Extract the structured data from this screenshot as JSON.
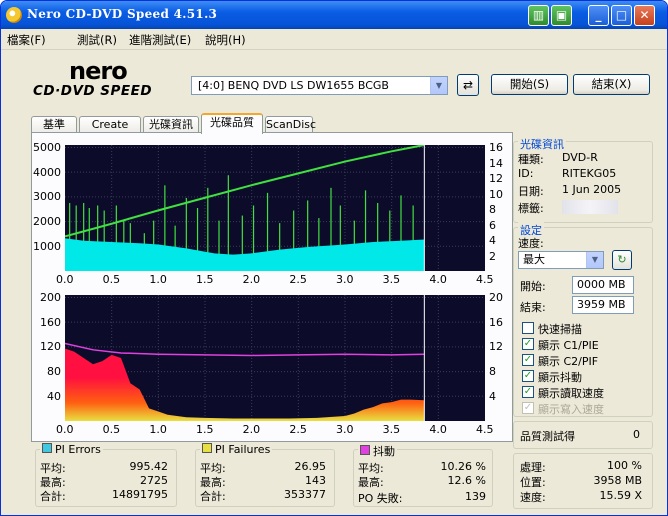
{
  "window": {
    "title": "Nero CD-DVD Speed 4.51.3"
  },
  "menu": [
    "檔案(F)",
    "測試(R)",
    "進階測試(E)",
    "說明(H)"
  ],
  "logo": {
    "brand": "nero",
    "product": "CD·DVD SPEED"
  },
  "drive": {
    "selected": "[4:0]  BENQ DVD LS DW1655 BCGB"
  },
  "buttons": {
    "start": "開始(S)",
    "end": "結束(X)"
  },
  "tabs": [
    "基準",
    "Create Disc",
    "光碟資訊",
    "光碟品質",
    "ScanDisc"
  ],
  "active_tab": "光碟品質",
  "disc_info": {
    "header": "光碟資訊",
    "type_label": "種類:",
    "type_value": "DVD-R",
    "id_label": "ID:",
    "id_value": "RITEKG05",
    "date_label": "日期:",
    "date_value": "1 Jun 2005",
    "label_label": "標籤:",
    "label_value": ""
  },
  "settings": {
    "header": "設定",
    "speed_label": "速度:",
    "speed_value": "最大",
    "start_label": "開始:",
    "start_value": "0000 MB",
    "end_label": "結束:",
    "end_value": "3959 MB",
    "checkboxes": [
      {
        "label": "快速掃描",
        "checked": false,
        "enabled": true
      },
      {
        "label": "顯示 C1/PIE",
        "checked": true,
        "enabled": true
      },
      {
        "label": "顯示 C2/PIF",
        "checked": true,
        "enabled": true
      },
      {
        "label": "顯示抖動",
        "checked": true,
        "enabled": true
      },
      {
        "label": "顯示讀取速度",
        "checked": true,
        "enabled": true
      },
      {
        "label": "顯示寫入速度",
        "checked": true,
        "enabled": false
      }
    ]
  },
  "quality": {
    "label": "品質測試得",
    "value": "0"
  },
  "progress": {
    "process_label": "處理:",
    "process_value": "100 %",
    "position_label": "位置:",
    "position_value": "3958 MB",
    "speed_label": "速度:",
    "speed_value": "15.59 X"
  },
  "pi_errors": {
    "title": "PI Errors",
    "color": "#40c8e0",
    "avg_label": "平均:",
    "avg": "995.42",
    "max_label": "最高:",
    "max": "2725",
    "total_label": "合計:",
    "total": "14891795"
  },
  "pi_failures": {
    "title": "PI Failures",
    "color": "#e8e040",
    "avg_label": "平均:",
    "avg": "26.95",
    "max_label": "最高:",
    "max": "143",
    "total_label": "合計:",
    "total": "353377"
  },
  "jitter": {
    "title": "抖動",
    "color": "#e040e0",
    "avg_label": "平均:",
    "avg": "10.26 %",
    "max_label": "最高:",
    "max": "12.6 %",
    "po_label": "PO 失敗:",
    "po": "139"
  },
  "chart_data": [
    {
      "type": "area",
      "x_ticks": [
        "0.0",
        "0.5",
        "1.0",
        "1.5",
        "2.0",
        "2.5",
        "3.0",
        "3.5",
        "4.0",
        "4.5"
      ],
      "y_left_ticks": [
        "5000",
        "4000",
        "3000",
        "2000",
        "1000"
      ],
      "y_right_ticks": [
        "16",
        "14",
        "12",
        "10",
        "8",
        "6",
        "4",
        "2"
      ],
      "xlim": [
        0,
        4.5
      ],
      "ylim_left": [
        0,
        5000
      ],
      "ylim_right": [
        0,
        16
      ],
      "series": [
        {
          "color": "#00e8e8",
          "x": [
            0.0,
            0.2,
            0.5,
            0.8,
            1.0,
            1.3,
            1.6,
            1.8,
            2.0,
            2.3,
            2.6,
            3.0,
            3.3,
            3.6,
            3.85
          ],
          "y": [
            1300,
            1200,
            1150,
            1100,
            1050,
            900,
            700,
            650,
            700,
            850,
            950,
            1050,
            1150,
            1200,
            1250
          ]
        },
        {
          "color": "#40e040",
          "x": [
            0.0,
            0.5,
            1.0,
            1.5,
            2.0,
            2.5,
            3.0,
            3.5,
            3.85
          ],
          "y": [
            4.4,
            6.0,
            7.7,
            9.3,
            10.9,
            12.4,
            13.9,
            15.2,
            16.0
          ]
        }
      ],
      "spikes_x": [
        0.05,
        0.12,
        0.2,
        0.26,
        0.35,
        0.42,
        0.55,
        0.63,
        0.7,
        0.85,
        0.95,
        1.07,
        1.18,
        1.3,
        1.42,
        1.53,
        1.65,
        1.75,
        1.9,
        2.02,
        2.17,
        2.3,
        2.45,
        2.6,
        2.72,
        2.85,
        2.95,
        3.1,
        3.22,
        3.35,
        3.48,
        3.6,
        3.73
      ],
      "spikes_y": [
        2700,
        2600,
        2700,
        2500,
        2600,
        2400,
        2600,
        2000,
        1900,
        1500,
        2000,
        3400,
        1800,
        2900,
        2500,
        3300,
        2000,
        3800,
        2200,
        2600,
        3100,
        1900,
        2400,
        2800,
        2100,
        3300,
        2600,
        2000,
        3200,
        2700,
        2400,
        3000,
        2600
      ]
    },
    {
      "type": "area",
      "x_ticks": [
        "0.0",
        "0.5",
        "1.0",
        "1.5",
        "2.0",
        "2.5",
        "3.0",
        "3.5",
        "4.0",
        "4.5"
      ],
      "y_left_ticks": [
        "200",
        "160",
        "120",
        "80",
        "40"
      ],
      "y_right_ticks": [
        "20",
        "16",
        "12",
        "8",
        "4"
      ],
      "xlim": [
        0,
        4.5
      ],
      "ylim_left": [
        0,
        200
      ],
      "ylim_right": [
        0,
        20
      ],
      "series": [
        {
          "color": "#ff2020",
          "x": [
            0.0,
            0.1,
            0.2,
            0.3,
            0.4,
            0.5,
            0.6,
            0.7,
            0.8,
            0.9,
            1.0,
            1.1,
            1.2,
            1.3,
            1.5,
            1.8,
            2.1,
            2.4,
            2.7,
            3.0,
            3.1,
            3.2,
            3.3,
            3.4,
            3.5,
            3.6,
            3.7,
            3.85
          ],
          "y": [
            115,
            110,
            100,
            90,
            95,
            105,
            100,
            60,
            50,
            20,
            15,
            10,
            8,
            6,
            5,
            4,
            4,
            4,
            5,
            8,
            12,
            18,
            22,
            28,
            30,
            34,
            34,
            33
          ]
        },
        {
          "color": "#e040e0",
          "x": [
            0.0,
            0.3,
            0.6,
            1.0,
            1.5,
            2.0,
            2.5,
            3.0,
            3.5,
            3.85
          ],
          "y": [
            12.3,
            11.3,
            10.8,
            10.6,
            10.5,
            10.4,
            10.5,
            10.6,
            10.5,
            10.6
          ]
        }
      ]
    }
  ]
}
